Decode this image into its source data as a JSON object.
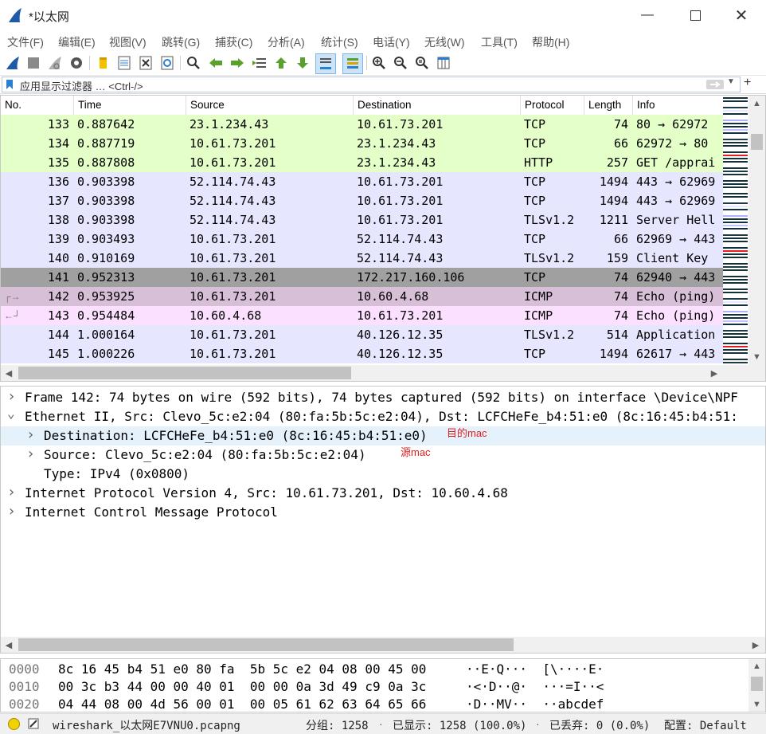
{
  "window": {
    "title": "*以太网"
  },
  "menu": [
    "文件(F)",
    "编辑(E)",
    "视图(V)",
    "跳转(G)",
    "捕获(C)",
    "分析(A)",
    "统计(S)",
    "电话(Y)",
    "无线(W)",
    "工具(T)",
    "帮助(H)"
  ],
  "filter": {
    "placeholder": "应用显示过滤器 … <Ctrl-/>"
  },
  "packet_list": {
    "columns": [
      "No.",
      "Time",
      "Source",
      "Destination",
      "Protocol",
      "Length",
      "Info"
    ],
    "rows": [
      {
        "no": "133",
        "time": "0.887642",
        "src": "23.1.234.43",
        "dst": "10.61.73.201",
        "proto": "TCP",
        "len": "74",
        "info": "80 → 62972",
        "bg": "#e4ffc7"
      },
      {
        "no": "134",
        "time": "0.887719",
        "src": "10.61.73.201",
        "dst": "23.1.234.43",
        "proto": "TCP",
        "len": "66",
        "info": "62972 → 80",
        "bg": "#e4ffc7"
      },
      {
        "no": "135",
        "time": "0.887808",
        "src": "10.61.73.201",
        "dst": "23.1.234.43",
        "proto": "HTTP",
        "len": "257",
        "info": "GET /apprai",
        "bg": "#e4ffc7"
      },
      {
        "no": "136",
        "time": "0.903398",
        "src": "52.114.74.43",
        "dst": "10.61.73.201",
        "proto": "TCP",
        "len": "1494",
        "info": "443 → 62969",
        "bg": "#e7e6ff"
      },
      {
        "no": "137",
        "time": "0.903398",
        "src": "52.114.74.43",
        "dst": "10.61.73.201",
        "proto": "TCP",
        "len": "1494",
        "info": "443 → 62969",
        "bg": "#e7e6ff"
      },
      {
        "no": "138",
        "time": "0.903398",
        "src": "52.114.74.43",
        "dst": "10.61.73.201",
        "proto": "TLSv1.2",
        "len": "1211",
        "info": "Server Hell",
        "bg": "#e7e6ff"
      },
      {
        "no": "139",
        "time": "0.903493",
        "src": "10.61.73.201",
        "dst": "52.114.74.43",
        "proto": "TCP",
        "len": "66",
        "info": "62969 → 443",
        "bg": "#e7e6ff"
      },
      {
        "no": "140",
        "time": "0.910169",
        "src": "10.61.73.201",
        "dst": "52.114.74.43",
        "proto": "TLSv1.2",
        "len": "159",
        "info": "Client Key",
        "bg": "#e7e6ff"
      },
      {
        "no": "141",
        "time": "0.952313",
        "src": "10.61.73.201",
        "dst": "172.217.160.106",
        "proto": "TCP",
        "len": "74",
        "info": "62940 → 443",
        "bg": "#a0a0a0"
      },
      {
        "no": "142",
        "time": "0.953925",
        "src": "10.61.73.201",
        "dst": "10.60.4.68",
        "proto": "ICMP",
        "len": "74",
        "info": "Echo (ping)",
        "bg": "#d8bfd8"
      },
      {
        "no": "143",
        "time": "0.954484",
        "src": "10.60.4.68",
        "dst": "10.61.73.201",
        "proto": "ICMP",
        "len": "74",
        "info": "Echo (ping)",
        "bg": "#fce0ff"
      },
      {
        "no": "144",
        "time": "1.000164",
        "src": "10.61.73.201",
        "dst": "40.126.12.35",
        "proto": "TLSv1.2",
        "len": "514",
        "info": "Application",
        "bg": "#e7e6ff"
      },
      {
        "no": "145",
        "time": "1.000226",
        "src": "10.61.73.201",
        "dst": "40.126.12.35",
        "proto": "TCP",
        "len": "1494",
        "info": "62617 → 443",
        "bg": "#e7e6ff"
      }
    ]
  },
  "details": [
    {
      "text": "Frame 142: 74 bytes on wire (592 bits), 74 bytes captured (592 bits) on interface \\Device\\NPF",
      "indent": 0,
      "expanded": false
    },
    {
      "text": "Ethernet II, Src: Clevo_5c:e2:04 (80:fa:5b:5c:e2:04), Dst: LCFCHeFe_b4:51:e0 (8c:16:45:b4:51:",
      "indent": 0,
      "expanded": true
    },
    {
      "text": "Destination: LCFCHeFe_b4:51:e0 (8c:16:45:b4:51:e0)",
      "indent": 1,
      "expanded": false,
      "annotation": "目的mac",
      "selected": true
    },
    {
      "text": "Source: Clevo_5c:e2:04 (80:fa:5b:5c:e2:04)",
      "indent": 1,
      "expanded": false,
      "annotation": "源mac"
    },
    {
      "text": "Type: IPv4 (0x0800)",
      "indent": 1,
      "leaf": true
    },
    {
      "text": "Internet Protocol Version 4, Src: 10.61.73.201, Dst: 10.60.4.68",
      "indent": 0,
      "expanded": false
    },
    {
      "text": "Internet Control Message Protocol",
      "indent": 0,
      "expanded": false
    }
  ],
  "bytes": [
    {
      "offset": "0000",
      "hex": "8c 16 45 b4 51 e0 80 fa  5b 5c e2 04 08 00 45 00",
      "ascii": "··E·Q···  [\\····E·"
    },
    {
      "offset": "0010",
      "hex": "00 3c b3 44 00 00 40 01  00 00 0a 3d 49 c9 0a 3c",
      "ascii": "·<·D··@·  ···=I··<"
    },
    {
      "offset": "0020",
      "hex": "04 44 08 00 4d 56 00 01  00 05 61 62 63 64 65 66",
      "ascii": "·D··MV··  ··abcdef"
    }
  ],
  "status": {
    "file": "wireshark_以太网E7VNU0.pcapng",
    "packets": "分组: 1258",
    "displayed": "已显示: 1258 (100.0%)",
    "dropped": "已丢弃: 0 (0.0%)",
    "profile": "配置: Default"
  },
  "colors": {
    "accent": "#1e5aa8",
    "annotation": "#e02020",
    "selected_detail": "#e5f1fb"
  }
}
